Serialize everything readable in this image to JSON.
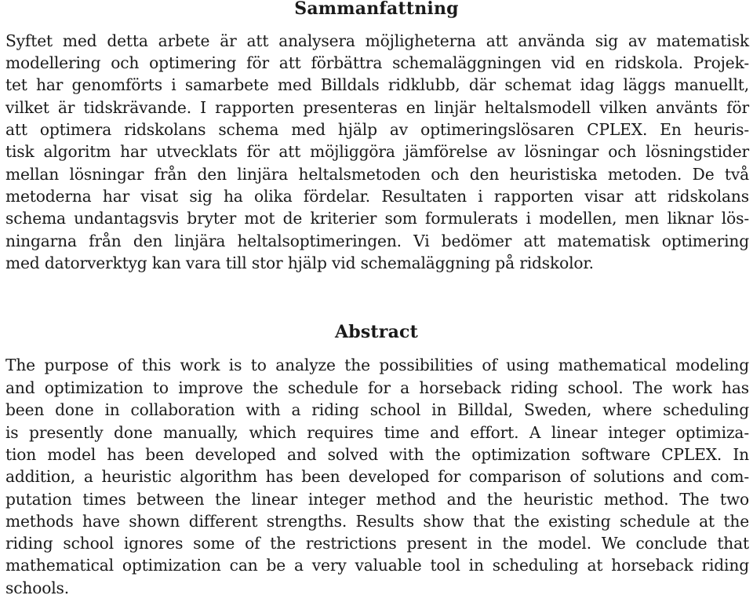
{
  "document": {
    "sections": [
      {
        "id": "sammanfattning",
        "heading": "Sammanfattning",
        "lines": [
          "Syftet med detta arbete är att analysera möjligheterna att använda sig av matematisk",
          "modellering och optimering för att förbättra schemaläggningen vid en ridskola. Projek-",
          "tet har genomförts i samarbete med Billdals ridklubb, där schemat idag läggs manuellt,",
          "vilket är tidskrävande. I rapporten presenteras en linjär heltalsmodell vilken använts för",
          "att optimera ridskolans schema med hjälp av optimeringslösaren CPLEX. En heuris-",
          "tisk algoritm har utvecklats för att möjliggöra jämförelse av lösningar och lösningstider",
          "mellan lösningar från den linjära heltalsmetoden och den heuristiska metoden. De två",
          "metoderna har visat sig ha olika fördelar. Resultaten i rapporten visar att ridskolans",
          "schema undantagsvis bryter mot de kriterier som formulerats i modellen, men liknar lös-",
          "ningarna från den linjära heltalsoptimeringen. Vi bedömer att matematisk optimering",
          "med datorverktyg kan vara till stor hjälp vid schemaläggning på ridskolor."
        ]
      },
      {
        "id": "abstract",
        "heading": "Abstract",
        "lines": [
          "The purpose of this work is to analyze the possibilities of using mathematical modeling",
          "and optimization to improve the schedule for a horseback riding school. The work has",
          "been done in collaboration with a riding school in Billdal, Sweden, where scheduling",
          "is presently done manually, which requires time and effort. A linear integer optimiza-",
          "tion model has been developed and solved with the optimization software CPLEX. In",
          "addition, a heuristic algorithm has been developed for comparison of solutions and com-",
          "putation times between the linear integer method and the heuristic method. The two",
          "methods have shown different strengths. Results show that the existing schedule at the",
          "riding school ignores some of the restrictions present in the model. We conclude that",
          "mathematical optimization can be a very valuable tool in scheduling at horseback riding",
          "schools."
        ]
      }
    ]
  }
}
